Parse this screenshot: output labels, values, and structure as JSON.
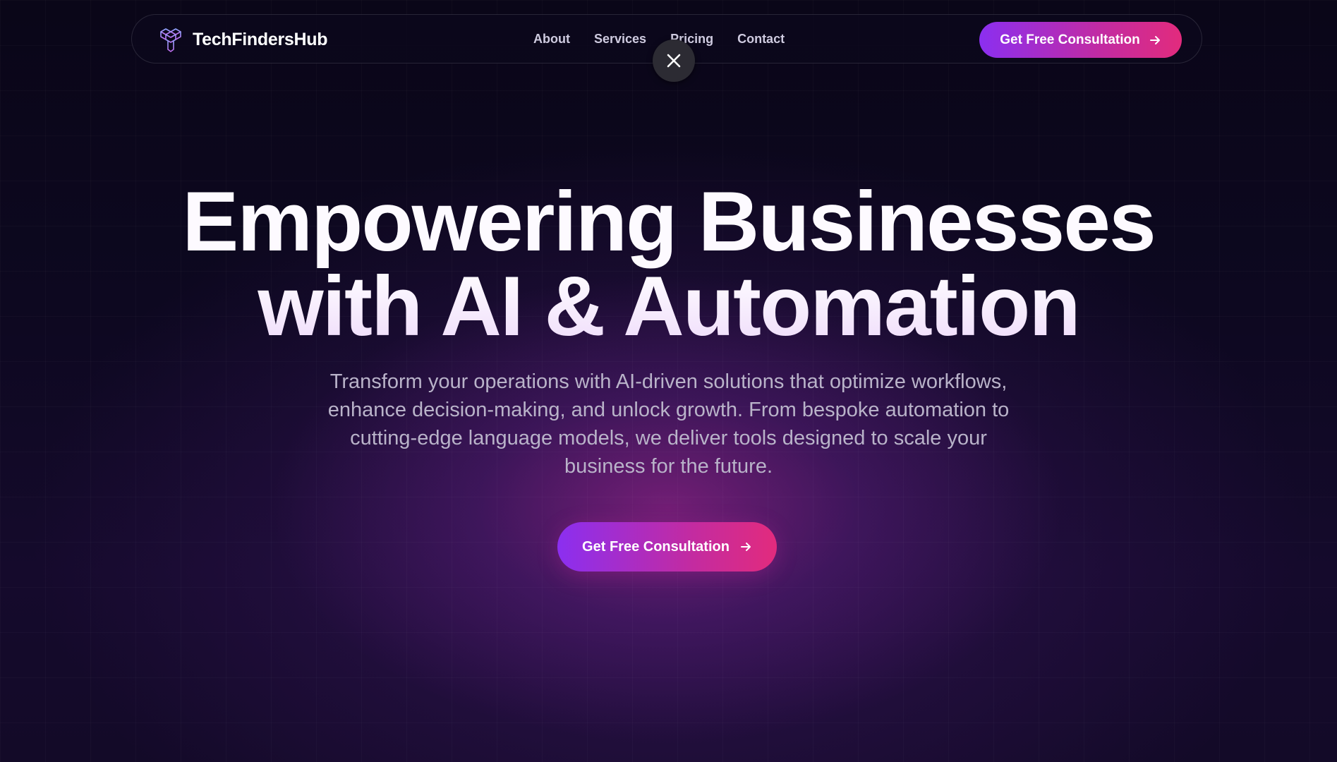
{
  "brand": {
    "name": "TechFindersHub",
    "icon": "cube-stack-logo-icon"
  },
  "nav": {
    "links": [
      "About",
      "Services",
      "Pricing",
      "Contact"
    ],
    "cta_label": "Get Free Consultation",
    "cta_icon": "arrow-right-icon"
  },
  "overlay": {
    "close_icon": "close-icon"
  },
  "hero": {
    "title_line1": "Empowering Businesses",
    "title_line2": "with AI & Automation",
    "subtitle": "Transform your operations with AI-driven solutions that optimize workflows, enhance decision-making, and unlock growth. From bespoke automation to cutting-edge language models, we deliver tools designed to scale your business for the future.",
    "cta_label": "Get Free Consultation",
    "cta_icon": "arrow-right-icon"
  },
  "colors": {
    "background": "#0b0719",
    "accent_start": "#8b2ff0",
    "accent_end": "#e22b7d",
    "text_primary": "#ffffff",
    "text_muted": "#b9b3c9",
    "close_button_bg": "#2c2b33"
  }
}
